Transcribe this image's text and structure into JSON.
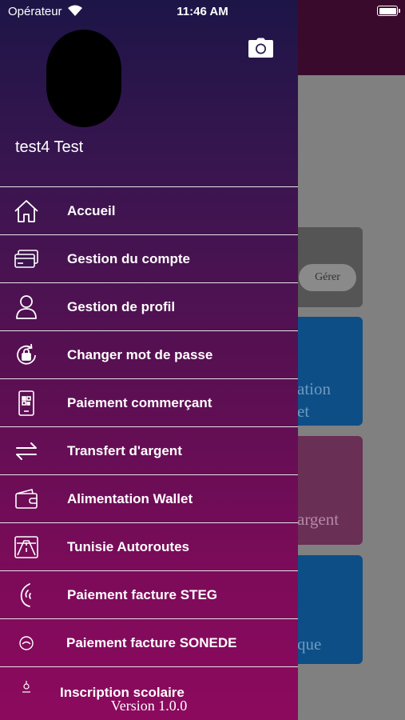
{
  "status_bar": {
    "carrier": "Opérateur",
    "time": "11:46 AM",
    "wifi_icon": "wifi-icon",
    "battery_icon": "battery-icon"
  },
  "background": {
    "manage_button": "Gérer",
    "card2_text_line1": "ation",
    "card2_text_line2": "et",
    "card3_text": "argent",
    "card4_text": "que",
    "colors": {
      "header": "#3a0a2c",
      "blue_card": "#0e4e86",
      "purple_card": "#6a2f55"
    }
  },
  "drawer": {
    "user_name": "test4 Test",
    "camera_icon": "camera-icon",
    "colors": {
      "top": "#1d1547",
      "bottom": "#8c0a5e",
      "divider": "#e8e2ea"
    },
    "items": [
      {
        "label": "Accueil",
        "icon": "home-icon"
      },
      {
        "label": "Gestion du compte",
        "icon": "cards-icon"
      },
      {
        "label": "Gestion de profil",
        "icon": "user-icon"
      },
      {
        "label": "Changer mot de passe",
        "icon": "lock-refresh-icon"
      },
      {
        "label": "Paiement commerçant",
        "icon": "phone-qr-icon"
      },
      {
        "label": "Transfert d'argent",
        "icon": "transfer-arrows-icon"
      },
      {
        "label": "Alimentation Wallet",
        "icon": "wallet-icon"
      },
      {
        "label": "Tunisie Autoroutes",
        "icon": "highway-icon"
      },
      {
        "label": "Paiement facture STEG",
        "icon": "steg-logo-icon"
      },
      {
        "label": "Paiement facture SONEDE",
        "icon": "sonede-logo-icon"
      },
      {
        "label": "Inscription scolaire",
        "icon": "school-icon"
      }
    ],
    "version": "Version 1.0.0"
  }
}
